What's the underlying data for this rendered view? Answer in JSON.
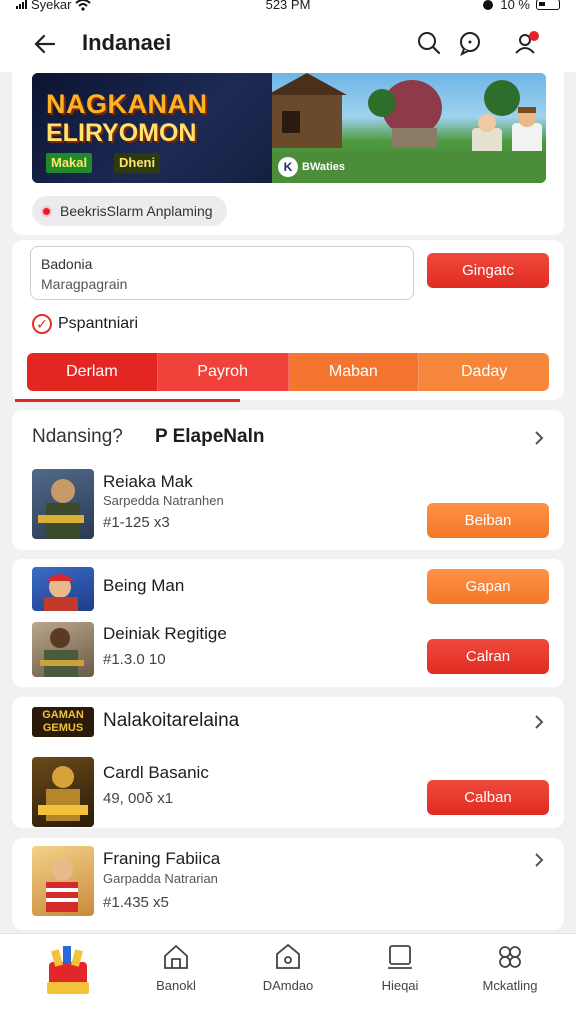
{
  "status_bar": {
    "carrier": "Syekar",
    "time": "523 PM",
    "battery": "10 %"
  },
  "header": {
    "title": "Indanaei",
    "icons": [
      "back-arrow-icon",
      "search-icon",
      "chat-icon",
      "user-notification-icon"
    ]
  },
  "banner": {
    "title_line1": "NAGKANAN",
    "title_line2": "ELIRYOMON",
    "tag1": "Makal",
    "tag2": "Dheni",
    "brand": "BWaties"
  },
  "chip": {
    "label": "BeekrisSlarm Anplaming"
  },
  "form": {
    "input_line1": "Badonia",
    "input_line2": "Maragpagrain",
    "submit_label": "Gingatc",
    "checkbox_label": "Pspantniari",
    "checkbox_checked": true
  },
  "tabs": [
    {
      "label": "Derlam",
      "active": true
    },
    {
      "label": "Payroh",
      "active": false
    },
    {
      "label": "Maban",
      "active": false
    },
    {
      "label": "Daday",
      "active": false
    }
  ],
  "section1": {
    "heading": "Ndansing?",
    "heading_right": "P ElapeNaln",
    "items": [
      {
        "name": "Reiaka Mak",
        "sub": "Sarpedda Natranhen",
        "price": "#1-125 x3",
        "button": "Beiban",
        "button_color": "orange"
      }
    ]
  },
  "section2": {
    "items": [
      {
        "name": "Being Man",
        "button": "Gapan",
        "button_color": "orange"
      },
      {
        "name": "Deiniak Regitige",
        "price": "#1.3.0 10",
        "button": "Calran",
        "button_color": "red"
      }
    ]
  },
  "section3": {
    "logo_text": "GAMAN GEMUS",
    "heading": "Nalakoitarelaina",
    "items": [
      {
        "name": "Cardl Basanic",
        "price": "49, 00δ x1",
        "button": "Calban",
        "button_color": "red"
      }
    ]
  },
  "section4": {
    "items": [
      {
        "name": "Franing Fabiica",
        "sub": "Garpadda Natrarian",
        "price": "#1.435 x5"
      }
    ]
  },
  "bottom_nav": [
    {
      "label": "",
      "icon": "game-logo-icon"
    },
    {
      "label": "Banokl",
      "icon": "home-icon"
    },
    {
      "label": "DAmdao",
      "icon": "tag-icon"
    },
    {
      "label": "Hieqai",
      "icon": "tablet-icon"
    },
    {
      "label": "Mckatling",
      "icon": "puzzle-icon"
    }
  ],
  "colors": {
    "accent_red": "#e32622",
    "accent_orange": "#f27728",
    "background": "#f1f1f3"
  }
}
